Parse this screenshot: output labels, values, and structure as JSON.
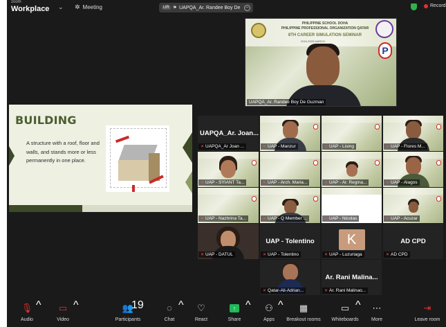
{
  "topbar": {
    "brand_small": "zoom",
    "brand": "Workplace",
    "meeting_label": "Meeting",
    "speaker_chip": {
      "badge": "UR",
      "text": "UAPQA_Ar. Randee Boy De"
    },
    "record_label": "Record"
  },
  "host_video": {
    "banner_line1": "PHILIPPINE SCHOOL DOHA",
    "banner_line2": "PHILIPPINE PROFESSIONAL ORGANIZATION QATAR",
    "banner_line3": "8TH CAREER SIMULATION SEMINAR",
    "banner_line4": "2024-2025 MARCH",
    "name": "UAPQA_Ar. Randee Boy De Guzman"
  },
  "slide": {
    "title": "BUILDING",
    "body": "A structure with a roof, floor and walls, and stands more or less permanently in one place."
  },
  "gallery": [
    {
      "big": "UAPQA_Ar. Joan...",
      "name": "UAPQA_Ar Joan ..."
    },
    {
      "big": "",
      "name": "UAP - Manzur"
    },
    {
      "big": "",
      "name": "UAP - Lising"
    },
    {
      "big": "",
      "name": "UAP - Flores M..."
    },
    {
      "big": "",
      "name": "UAP - SYIANT Ta..."
    },
    {
      "big": "",
      "name": "UAP - Arch. Maria..."
    },
    {
      "big": "",
      "name": "UAP - Ar. Regina..."
    },
    {
      "big": "",
      "name": "UAP - Alagos"
    },
    {
      "big": "",
      "name": "UAP - Nazhrina Ta..."
    },
    {
      "big": "",
      "name": "UAP - Q Member ..."
    },
    {
      "big": "",
      "name": "UAP - Nicolas"
    },
    {
      "big": "",
      "name": "UAP - Acuzar"
    },
    {
      "big": "",
      "name": "UAP - DATUL"
    },
    {
      "big": "UAP - Tolentino",
      "name": "UAP - Tolentino"
    },
    {
      "big": "",
      "avatar": "K",
      "name": "UAP - Luzuriaga"
    },
    {
      "big": "AD CPD",
      "name": "AD CPD"
    },
    {
      "big": "",
      "name": "Qatar-Ali-Adrian..."
    },
    {
      "big": "Ar. Rani Malina...",
      "name": "Ar. Rani Malinao..."
    }
  ],
  "toolbar": {
    "audio": "Audio",
    "video": "Video",
    "participants": "Participants",
    "participants_count": "19",
    "chat": "Chat",
    "react": "React",
    "share": "Share",
    "apps": "Apps",
    "breakout": "Breakout rooms",
    "whiteboards": "Whiteboards",
    "more": "More",
    "leave": "Leave room"
  }
}
